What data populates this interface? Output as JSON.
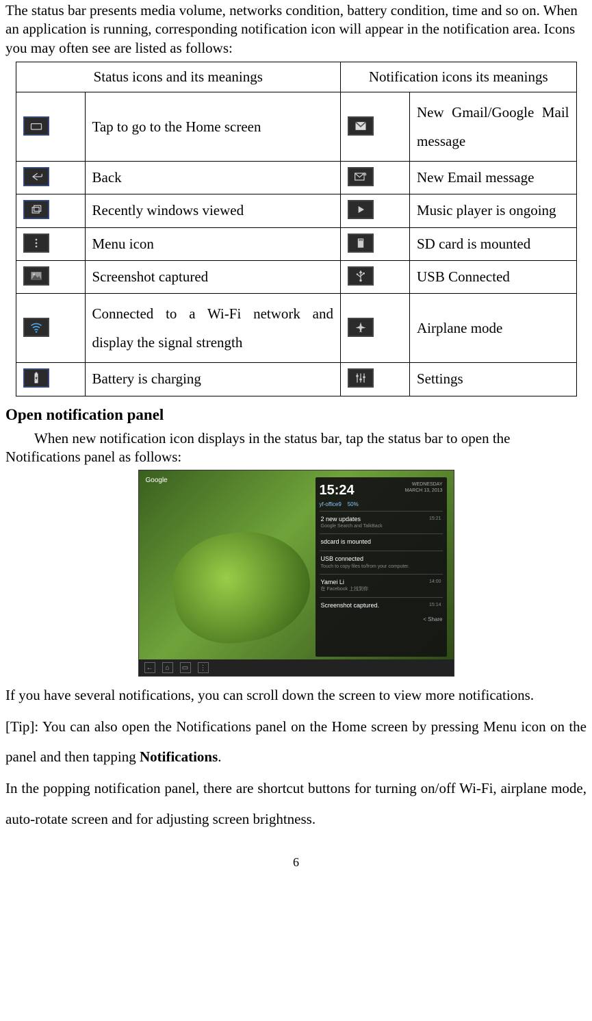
{
  "intro": "The status bar presents media volume, networks condition, battery condition, time and so on. When an application is running, corresponding notification icon will appear in the notification area. Icons you may often see are listed as follows:",
  "table": {
    "header_left": "Status icons and its meanings",
    "header_right": "Notification icons its meanings",
    "rows": [
      {
        "left": "Tap to go to the Home screen",
        "right": "New Gmail/Google Mail message",
        "right_justify": true
      },
      {
        "left": "Back",
        "right": "New Email message"
      },
      {
        "left": "Recently windows viewed",
        "right": "Music player is ongoing"
      },
      {
        "left": "Menu icon",
        "right": "SD card is mounted"
      },
      {
        "left": "Screenshot captured",
        "right": "USB Connected"
      },
      {
        "left": "Connected to a Wi-Fi network and display the signal strength",
        "left_justify": true,
        "right": "Airplane mode"
      },
      {
        "left": "Battery is charging",
        "right": "Settings"
      }
    ]
  },
  "heading": "Open notification panel",
  "para1": "When new notification icon displays in the status bar, tap the status bar to open the Notifications panel as follows:",
  "panel": {
    "google": "Google",
    "time": "15:24",
    "day": "WEDNESDAY",
    "date": "MARCH 13, 2013",
    "wifi": "yf-office9",
    "batt": "50%",
    "items": [
      {
        "t1": "2 new updates",
        "t2": "Google Search and TalkBack",
        "time": "15:21"
      },
      {
        "t1": "sdcard is mounted",
        "t2": ""
      },
      {
        "t1": "USB connected",
        "t2": "Touch to copy files to/from your computer."
      },
      {
        "t1": "Yamei Li",
        "t2": "在 Facebook 上找到你",
        "time": "14:00"
      },
      {
        "t1": "Screenshot captured.",
        "t2": "",
        "time": "15:14"
      }
    ],
    "share": "Share"
  },
  "para2": "If you have several notifications, you can scroll down the screen to view more notifications.",
  "para3_a": "[Tip]: You can also open the Notifications panel on the Home screen by pressing Menu icon on the panel and then tapping ",
  "para3_b": "Notifications",
  "para3_c": ".",
  "para4": "In the popping notification panel, there are shortcut buttons for turning on/off Wi-Fi, airplane mode, auto-rotate screen and for adjusting screen brightness.",
  "page": "6"
}
